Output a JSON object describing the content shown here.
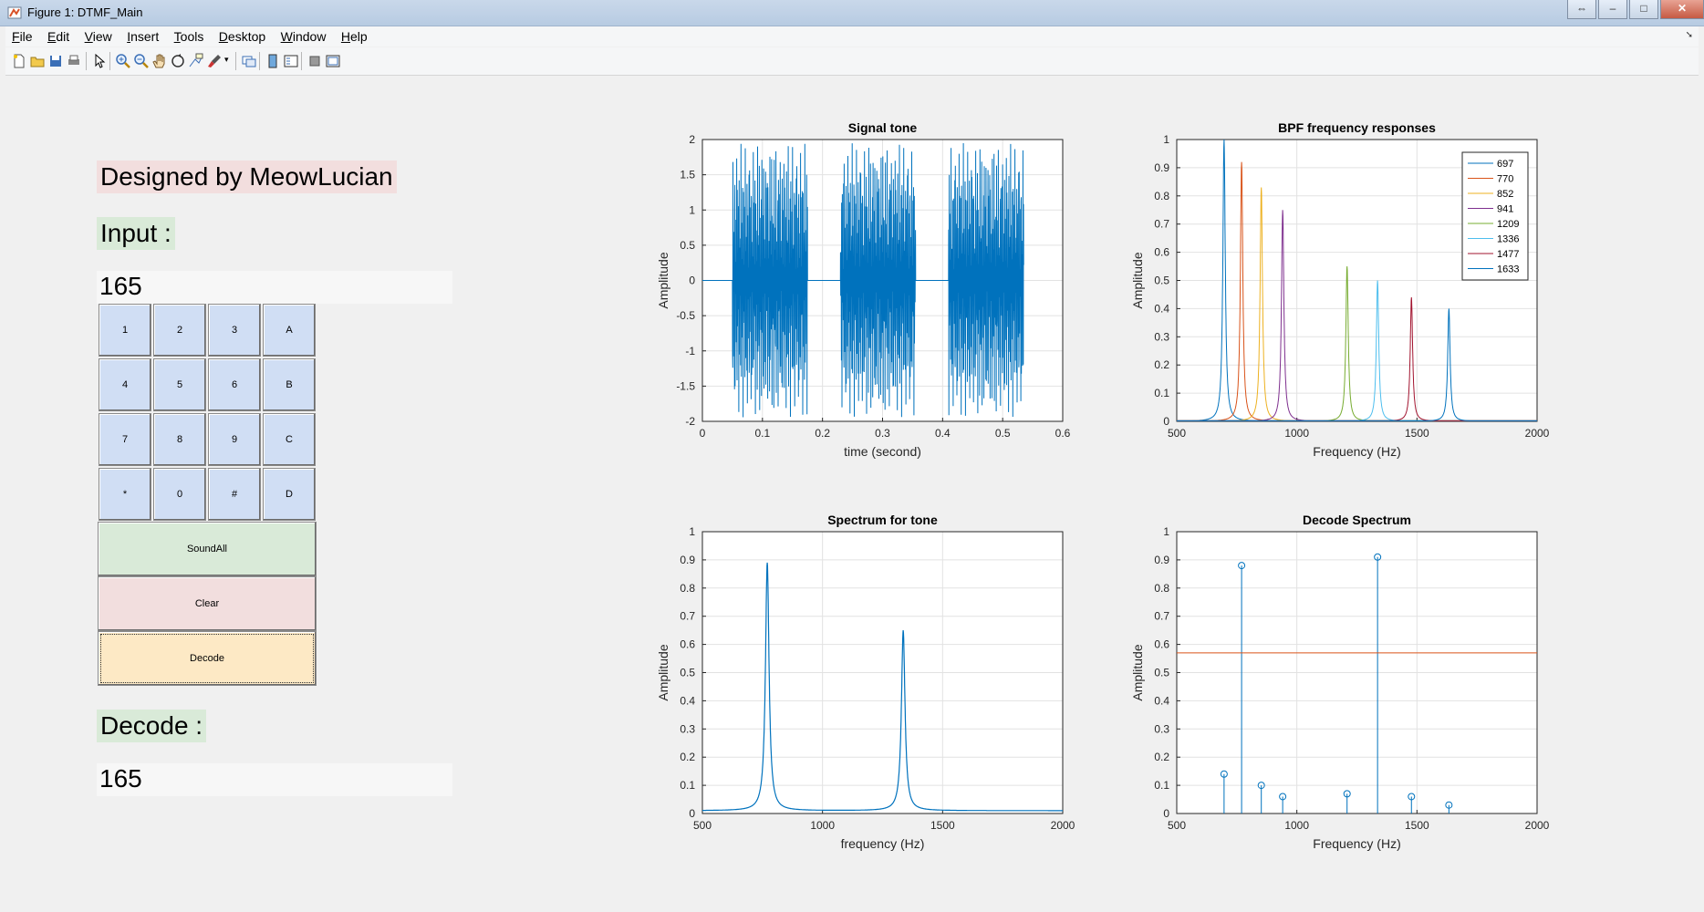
{
  "window": {
    "title": "Figure 1: DTMF_Main",
    "icon": "matlab-figure-icon"
  },
  "menubar": [
    {
      "key": "F",
      "rest": "ile"
    },
    {
      "key": "E",
      "rest": "dit"
    },
    {
      "key": "V",
      "rest": "iew"
    },
    {
      "key": "I",
      "rest": "nsert"
    },
    {
      "key": "T",
      "rest": "ools"
    },
    {
      "key": "D",
      "rest": "esktop"
    },
    {
      "key": "W",
      "rest": "indow"
    },
    {
      "key": "H",
      "rest": "elp"
    }
  ],
  "toolbar_icons": [
    "new-figure-icon",
    "open-file-icon",
    "save-icon",
    "print-icon",
    "edit-plot-arrow-icon",
    "zoom-in-icon",
    "zoom-out-icon",
    "pan-hand-icon",
    "rotate-3d-icon",
    "data-cursor-icon",
    "brush-icon",
    "link-plot-icon",
    "insert-colorbar-icon",
    "insert-legend-icon",
    "hide-plot-tools-icon",
    "show-plot-tools-icon"
  ],
  "panel": {
    "designer": "Designed by MeowLucian",
    "input_label": "Input :",
    "input_value": "165",
    "keys": [
      [
        "1",
        "2",
        "3",
        "A"
      ],
      [
        "4",
        "5",
        "6",
        "B"
      ],
      [
        "7",
        "8",
        "9",
        "C"
      ],
      [
        "*",
        "0",
        "#",
        "D"
      ]
    ],
    "soundall": "SoundAll",
    "clear": "Clear",
    "decode_btn": "Decode",
    "decode_label": "Decode :",
    "decode_value": "165"
  },
  "colors": {
    "designer_bg": "#f2dede",
    "label_bg": "#d9ead8",
    "key_bg": "#d0def4",
    "soundall_bg": "#d9ead8",
    "clear_bg": "#f2dede",
    "decode_bg": "#fde9c5",
    "matlab_blue": "#0072bd"
  },
  "chart_data": [
    {
      "type": "line",
      "title": "Signal tone",
      "xlabel": "time (second)",
      "ylabel": "Amplitude",
      "xlim": [
        0,
        0.6
      ],
      "ylim": [
        -2,
        2
      ],
      "xticks": [
        "0",
        "0.1",
        "0.2",
        "0.3",
        "0.4",
        "0.5",
        "0.6"
      ],
      "yticks": [
        "-2",
        "-1.5",
        "-1",
        "-0.5",
        "0",
        "0.5",
        "1",
        "1.5",
        "2"
      ],
      "grid": true,
      "tone_bursts": [
        [
          0.05,
          0.175
        ],
        [
          0.23,
          0.355
        ],
        [
          0.41,
          0.535
        ]
      ],
      "silence_value": 0,
      "burst_peak_amplitude": 1.95
    },
    {
      "type": "line",
      "title": "BPF frequency responses",
      "xlabel": "Frequency (Hz)",
      "ylabel": "Amplitude",
      "xlim": [
        500,
        2000
      ],
      "ylim": [
        0,
        1
      ],
      "xticks": [
        "500",
        "1000",
        "1500",
        "2000"
      ],
      "yticks": [
        "0",
        "0.1",
        "0.2",
        "0.3",
        "0.4",
        "0.5",
        "0.6",
        "0.7",
        "0.8",
        "0.9",
        "1"
      ],
      "grid": true,
      "legend_position": "top-right",
      "series": [
        {
          "name": "697",
          "center": 697,
          "peak": 1.0,
          "color": "#0072bd"
        },
        {
          "name": "770",
          "center": 770,
          "peak": 0.92,
          "color": "#d95319"
        },
        {
          "name": "852",
          "center": 852,
          "peak": 0.83,
          "color": "#edb120"
        },
        {
          "name": "941",
          "center": 941,
          "peak": 0.75,
          "color": "#7e2f8e"
        },
        {
          "name": "1209",
          "center": 1209,
          "peak": 0.55,
          "color": "#77ac30"
        },
        {
          "name": "1336",
          "center": 1336,
          "peak": 0.5,
          "color": "#4dbeee"
        },
        {
          "name": "1477",
          "center": 1477,
          "peak": 0.44,
          "color": "#a2142f"
        },
        {
          "name": "1633",
          "center": 1633,
          "peak": 0.4,
          "color": "#0072bd"
        }
      ]
    },
    {
      "type": "line",
      "title": "Spectrum for tone",
      "xlabel": "frequency (Hz)",
      "ylabel": "Amplitude",
      "xlim": [
        500,
        2000
      ],
      "ylim": [
        0,
        1
      ],
      "xticks": [
        "500",
        "1000",
        "1500",
        "2000"
      ],
      "yticks": [
        "0",
        "0.1",
        "0.2",
        "0.3",
        "0.4",
        "0.5",
        "0.6",
        "0.7",
        "0.8",
        "0.9",
        "1"
      ],
      "grid": true,
      "peaks": [
        {
          "x": 770,
          "y": 0.88
        },
        {
          "x": 1336,
          "y": 0.64
        }
      ],
      "baseline": 0.01
    },
    {
      "type": "scatter",
      "title": "Decode Spectrum",
      "xlabel": "Frequency (Hz)",
      "ylabel": "Amplitude",
      "xlim": [
        500,
        2000
      ],
      "ylim": [
        0,
        1
      ],
      "xticks": [
        "500",
        "1000",
        "1500",
        "2000"
      ],
      "yticks": [
        "0",
        "0.1",
        "0.2",
        "0.3",
        "0.4",
        "0.5",
        "0.6",
        "0.7",
        "0.8",
        "0.9",
        "1"
      ],
      "grid": true,
      "x": [
        697,
        770,
        852,
        941,
        1209,
        1336,
        1477,
        1633
      ],
      "y": [
        0.14,
        0.88,
        0.1,
        0.06,
        0.07,
        0.91,
        0.06,
        0.03
      ],
      "threshold": 0.57
    }
  ]
}
